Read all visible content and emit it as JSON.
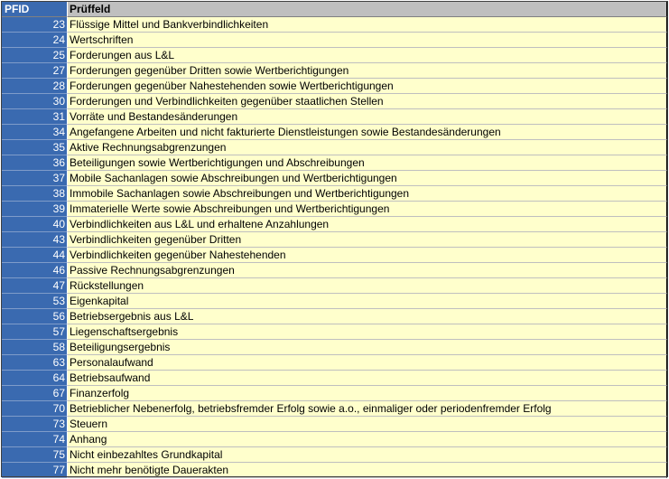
{
  "header": {
    "id_label": "PFID",
    "name_label": "Prüffeld"
  },
  "rows": [
    {
      "id": "23",
      "name": "Flüssige Mittel und Bankverbindlichkeiten"
    },
    {
      "id": "24",
      "name": "Wertschriften"
    },
    {
      "id": "25",
      "name": "Forderungen aus L&L"
    },
    {
      "id": "27",
      "name": "Forderungen gegenüber Dritten sowie Wertberichtigungen"
    },
    {
      "id": "28",
      "name": "Forderungen gegenüber Nahestehenden sowie Wertberichtigungen"
    },
    {
      "id": "30",
      "name": "Forderungen und Verbindlichkeiten gegenüber staatlichen Stellen"
    },
    {
      "id": "31",
      "name": "Vorräte und Bestandesänderungen"
    },
    {
      "id": "34",
      "name": "Angefangene Arbeiten und nicht fakturierte Dienstleistungen sowie Bestandesänderungen"
    },
    {
      "id": "35",
      "name": "Aktive Rechnungsabgrenzungen"
    },
    {
      "id": "36",
      "name": "Beteiligungen sowie Wertberichtigungen und Abschreibungen"
    },
    {
      "id": "37",
      "name": "Mobile Sachanlagen sowie Abschreibungen und Wertberichtigungen"
    },
    {
      "id": "38",
      "name": "Immobile Sachanlagen sowie Abschreibungen und Wertberichtigungen"
    },
    {
      "id": "39",
      "name": "Immaterielle Werte sowie Abschreibungen und Wertberichtigungen"
    },
    {
      "id": "40",
      "name": "Verbindlichkeiten aus L&L und erhaltene Anzahlungen"
    },
    {
      "id": "43",
      "name": "Verbindlichkeiten gegenüber Dritten"
    },
    {
      "id": "44",
      "name": "Verbindlichkeiten gegenüber Nahestehenden"
    },
    {
      "id": "46",
      "name": "Passive Rechnungsabgrenzungen"
    },
    {
      "id": "47",
      "name": "Rückstellungen"
    },
    {
      "id": "53",
      "name": "Eigenkapital"
    },
    {
      "id": "56",
      "name": "Betriebsergebnis aus L&L"
    },
    {
      "id": "57",
      "name": "Liegenschaftsergebnis"
    },
    {
      "id": "58",
      "name": "Beteiligungsergebnis"
    },
    {
      "id": "63",
      "name": "Personalaufwand"
    },
    {
      "id": "64",
      "name": "Betriebsaufwand"
    },
    {
      "id": "67",
      "name": "Finanzerfolg"
    },
    {
      "id": "70",
      "name": "Betrieblicher Nebenerfolg, betriebsfremder Erfolg sowie a.o., einmaliger oder periodenfremder Erfolg"
    },
    {
      "id": "73",
      "name": "Steuern"
    },
    {
      "id": "74",
      "name": "Anhang"
    },
    {
      "id": "75",
      "name": "Nicht einbezahltes Grundkapital"
    },
    {
      "id": "77",
      "name": "Nicht mehr benötigte Dauerakten"
    }
  ]
}
